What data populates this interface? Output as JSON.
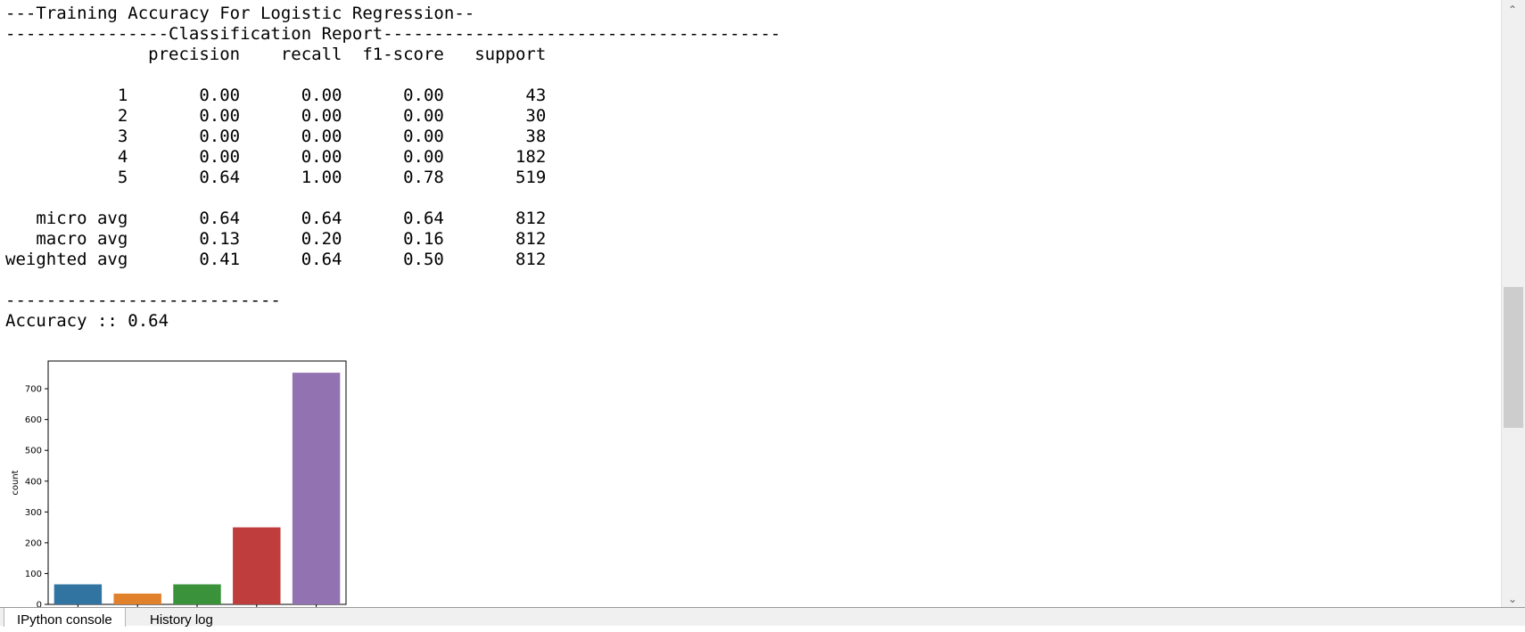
{
  "console": {
    "lines": [
      "---Training Accuracy For Logistic Regression--",
      "----------------Classification Report---------------------------------------",
      "              precision    recall  f1-score   support",
      "",
      "           1       0.00      0.00      0.00        43",
      "           2       0.00      0.00      0.00        30",
      "           3       0.00      0.00      0.00        38",
      "           4       0.00      0.00      0.00       182",
      "           5       0.64      1.00      0.78       519",
      "",
      "   micro avg       0.64      0.64      0.64       812",
      "   macro avg       0.13      0.20      0.16       812",
      "weighted avg       0.41      0.64      0.50       812",
      "",
      "---------------------------",
      "Accuracy :: 0.64"
    ]
  },
  "chart_data": {
    "type": "bar",
    "categories": [
      "",
      "",
      "",
      "",
      ""
    ],
    "values": [
      65,
      35,
      65,
      250,
      752
    ],
    "colors": [
      "#3274a1",
      "#e1812c",
      "#3a923a",
      "#c03d3e",
      "#9372b2"
    ],
    "title": "",
    "xlabel": "",
    "ylabel": "count",
    "ylim": [
      0,
      790
    ],
    "yticks": [
      0,
      100,
      200,
      300,
      400,
      500,
      600,
      700
    ],
    "grid": false
  },
  "tabs": [
    {
      "label": "IPython console"
    },
    {
      "label": "History log"
    }
  ],
  "scrollbar": {
    "up_glyph": "⌃",
    "down_glyph": "⌄"
  }
}
